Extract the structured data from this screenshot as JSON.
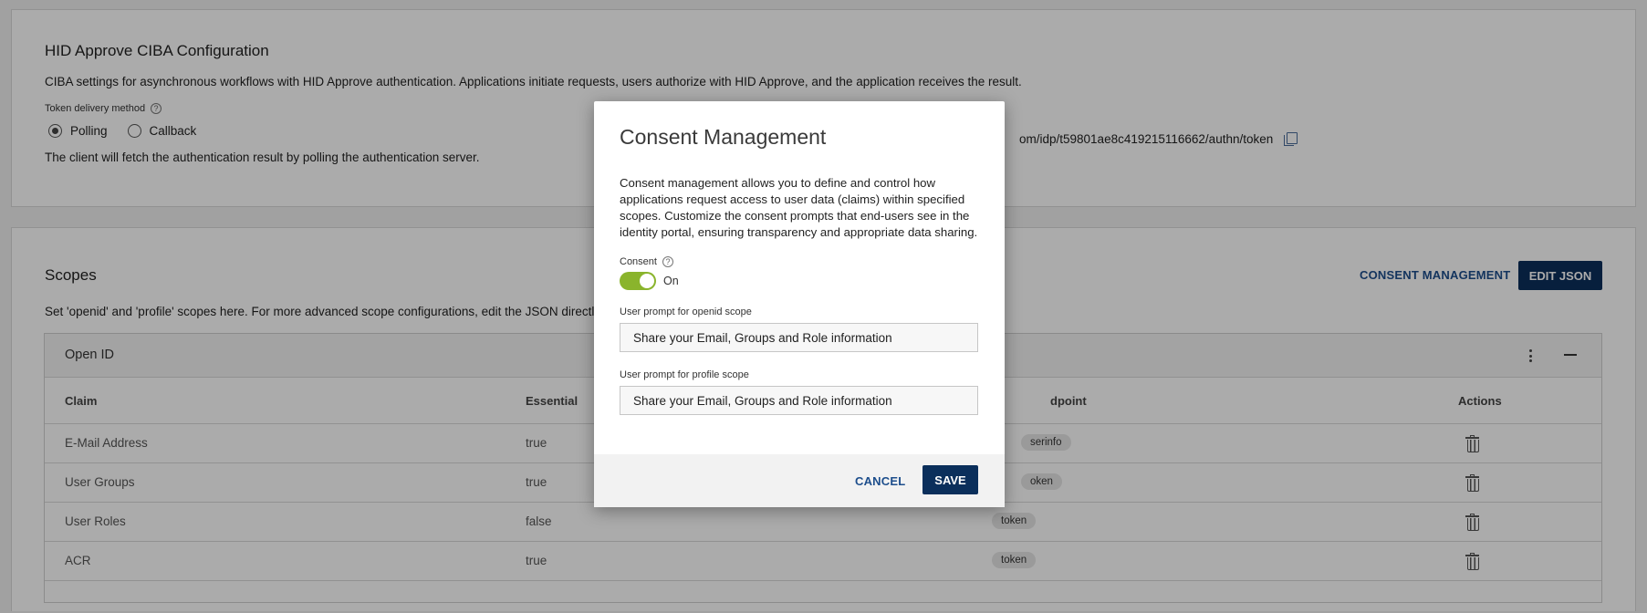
{
  "ciba": {
    "title": "HID Approve CIBA Configuration",
    "description": "CIBA settings for asynchronous workflows with HID Approve authentication. Applications initiate requests, users authorize with HID Approve, and the application receives the result.",
    "token_delivery_label": "Token delivery method",
    "options": [
      "Polling",
      "Callback"
    ],
    "selected_option": "Polling",
    "polling_note": "The client will fetch the authentication result by polling the authentication server.",
    "endpoint_partial": "om/idp/t59801ae8c419215116662/authn/token"
  },
  "scopes": {
    "title": "Scopes",
    "description": "Set 'openid' and 'profile' scopes here. For more advanced scope configurations, edit the JSON directly.",
    "consent_button": "CONSENT MANAGEMENT",
    "edit_json_button": "EDIT JSON",
    "panel": {
      "title": "Open ID",
      "columns": {
        "claim": "Claim",
        "essential": "Essential",
        "endpoint": "dpoint",
        "actions": "Actions"
      },
      "rows": [
        {
          "claim": "E-Mail Address",
          "essential": "true",
          "endpoint": "serinfo"
        },
        {
          "claim": "User Groups",
          "essential": "true",
          "endpoint": "oken"
        },
        {
          "claim": "User Roles",
          "essential": "false",
          "endpoint": "token"
        },
        {
          "claim": "ACR",
          "essential": "true",
          "endpoint": "token"
        }
      ]
    }
  },
  "modal": {
    "title": "Consent Management",
    "description": "Consent management allows you to define and control how applications request access to user data (claims) within specified scopes. Customize the consent prompts that end-users see in the identity portal, ensuring transparency and appropriate data sharing.",
    "consent_label": "Consent",
    "toggle_state": "On",
    "openid_label": "User prompt for openid scope",
    "openid_value": "Share your Email, Groups and Role information",
    "profile_label": "User prompt for profile scope",
    "profile_value": "Share your Email, Groups and Role information",
    "cancel": "CANCEL",
    "save": "SAVE"
  },
  "colors": {
    "primary": "#0b2f5b",
    "link": "#1d4e8c",
    "toggle_on": "#8ab42c"
  }
}
